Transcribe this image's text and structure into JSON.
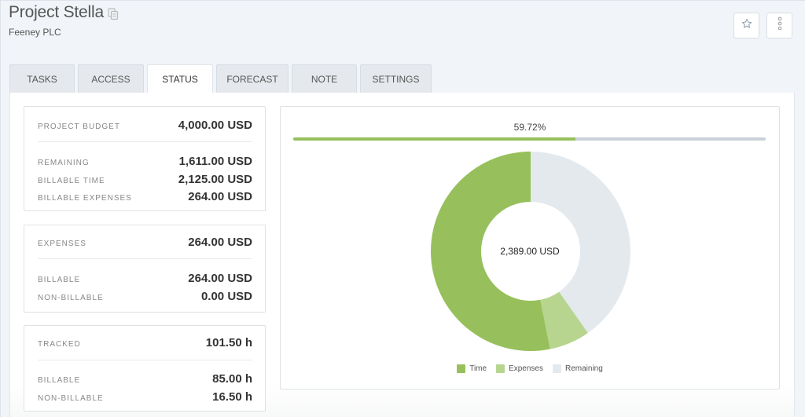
{
  "header": {
    "title": "Project Stella",
    "subtitle": "Feeney PLC",
    "copy_icon": "copy-icon",
    "star_icon": "star-icon",
    "more_icon": "more-vertical-icon"
  },
  "tabs": [
    {
      "label": "Tasks",
      "active": false
    },
    {
      "label": "Access",
      "active": false
    },
    {
      "label": "Status",
      "active": true
    },
    {
      "label": "Forecast",
      "active": false
    },
    {
      "label": "Note",
      "active": false
    },
    {
      "label": "Settings",
      "active": false
    }
  ],
  "budget_card": {
    "header": {
      "label": "Project Budget",
      "value": "4,000.00 USD"
    },
    "rows": [
      {
        "label": "Remaining",
        "value": "1,611.00 USD"
      },
      {
        "label": "Billable Time",
        "value": "2,125.00 USD"
      },
      {
        "label": "Billable Expenses",
        "value": "264.00 USD"
      }
    ]
  },
  "expenses_card": {
    "header": {
      "label": "Expenses",
      "value": "264.00 USD"
    },
    "rows": [
      {
        "label": "Billable",
        "value": "264.00 USD"
      },
      {
        "label": "Non-Billable",
        "value": "0.00 USD"
      }
    ]
  },
  "tracked_card": {
    "header": {
      "label": "Tracked",
      "value": "101.50 h"
    },
    "rows": [
      {
        "label": "Billable",
        "value": "85.00 h"
      },
      {
        "label": "Non-Billable",
        "value": "16.50 h"
      }
    ]
  },
  "chart_data": {
    "type": "pie",
    "variant": "donut",
    "progress_label": "59.72%",
    "progress_value": 0.5972,
    "center_label": "2,389.00 USD",
    "slices": [
      {
        "name": "Time",
        "value": 2125,
        "color": "#97c05c"
      },
      {
        "name": "Expenses",
        "value": 264,
        "color": "#b7d58f"
      },
      {
        "name": "Remaining",
        "value": 1611,
        "color": "#e4e9ed"
      }
    ],
    "legend": [
      "Time",
      "Expenses",
      "Remaining"
    ],
    "legend_position": "bottom",
    "start_angle": "top, clockwise: Remaining, Expenses, Time"
  },
  "colors": {
    "progress_track": "#c9d2da",
    "progress_fill": "#97c05c"
  }
}
